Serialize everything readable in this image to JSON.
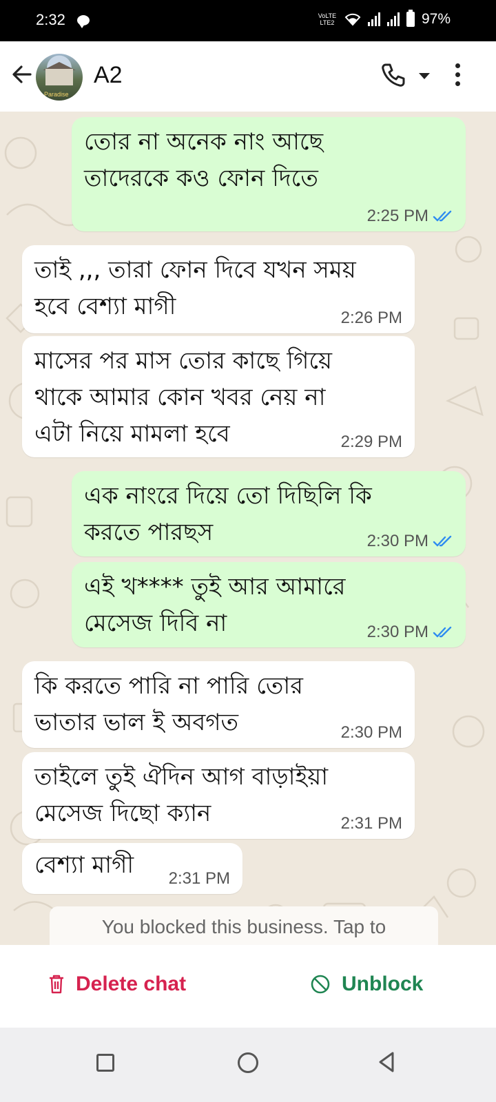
{
  "status_bar": {
    "time": "2:32",
    "network_label": "VoLTE LTE2",
    "battery": "97%"
  },
  "header": {
    "contact_name": "A2",
    "avatar_caption": "Paradise"
  },
  "messages": [
    {
      "direction": "outgoing",
      "text": "তোর না অনেক নাং আছে\nতাদেরকে কও ফোন দিতে",
      "time": "2:25 PM",
      "read": true
    },
    {
      "direction": "incoming",
      "text": "তাই ,,, তারা ফোন দিবে যখন সময়\nহবে বেশ্যা মাগী",
      "time": "2:26 PM"
    },
    {
      "direction": "incoming",
      "text": "মাসের পর মাস তোর কাছে গিয়ে\nথাকে আমার কোন খবর নেয় না\nএটা নিয়ে মামলা হবে",
      "time": "2:29 PM"
    },
    {
      "direction": "outgoing",
      "text": "এক নাংরে দিয়ে তো দিছিলি কি\nকরতে পারছস",
      "time": "2:30 PM",
      "read": true
    },
    {
      "direction": "outgoing",
      "text": "এই খ**** তুই আর আমারে\nমেসেজ দিবি না",
      "time": "2:30 PM",
      "read": true
    },
    {
      "direction": "incoming",
      "text": "কি করতে পারি না পারি তোর\nভাতার ভাল ই অবগত",
      "time": "2:30 PM"
    },
    {
      "direction": "incoming",
      "text": "তাইলে তুই ঐদিন আগ বাড়াইয়া\nমেসেজ দিছো ক্যান",
      "time": "2:31 PM"
    },
    {
      "direction": "incoming",
      "text": "বেশ্যা মাগী",
      "time": "2:31 PM"
    }
  ],
  "blocked_notice": "You blocked this business. Tap to",
  "actions": {
    "delete_label": "Delete chat",
    "unblock_label": "Unblock"
  },
  "colors": {
    "outgoing_bubble": "#d9fdd3",
    "incoming_bubble": "#ffffff",
    "delete": "#d6224f",
    "unblock": "#1f8552",
    "read_tick": "#2f8cf0"
  }
}
